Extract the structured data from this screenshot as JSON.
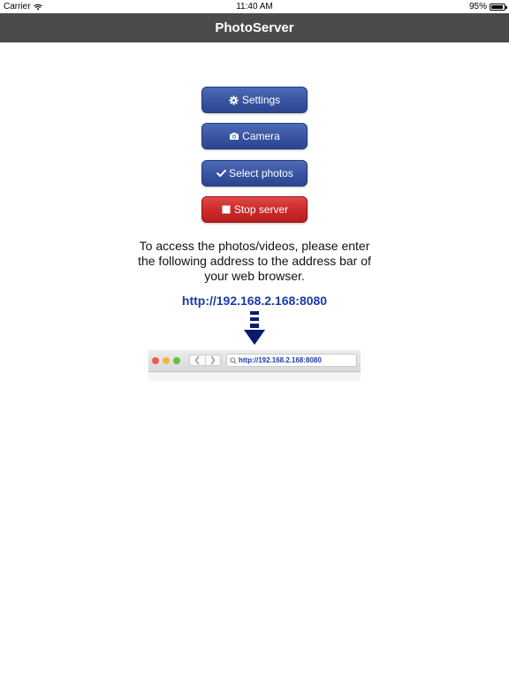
{
  "status_bar": {
    "carrier": "Carrier",
    "time": "11:40 AM",
    "battery": "95%",
    "battery_level": 0.95,
    "icons": [
      "wifi-icon",
      "battery-icon"
    ]
  },
  "nav": {
    "title": "PhotoServer"
  },
  "buttons": {
    "settings": {
      "label": "Settings",
      "icon": "gear-icon"
    },
    "camera": {
      "label": "Camera",
      "icon": "camera-icon"
    },
    "select_photos": {
      "label": "Select photos",
      "icon": "checkmark-icon"
    },
    "stop_server": {
      "label": "Stop server",
      "icon": "stop-square-icon"
    }
  },
  "instructions": {
    "text": "To access the photos/videos, please enter the following address to the address bar of your web browser.",
    "url": "http://192.168.2.168:8080"
  },
  "browser_illustration": {
    "address": "http://192.168.2.168:8080",
    "icons": [
      "down-arrow-icon",
      "back-arrow-icon",
      "forward-arrow-icon",
      "search-icon"
    ]
  },
  "colors": {
    "nav_bar": "#4b4b4b",
    "button_blue": "#3a56a3",
    "button_red": "#cc2b2b",
    "url_blue": "#1c3aa9",
    "arrow_navy": "#0b1a6e"
  }
}
